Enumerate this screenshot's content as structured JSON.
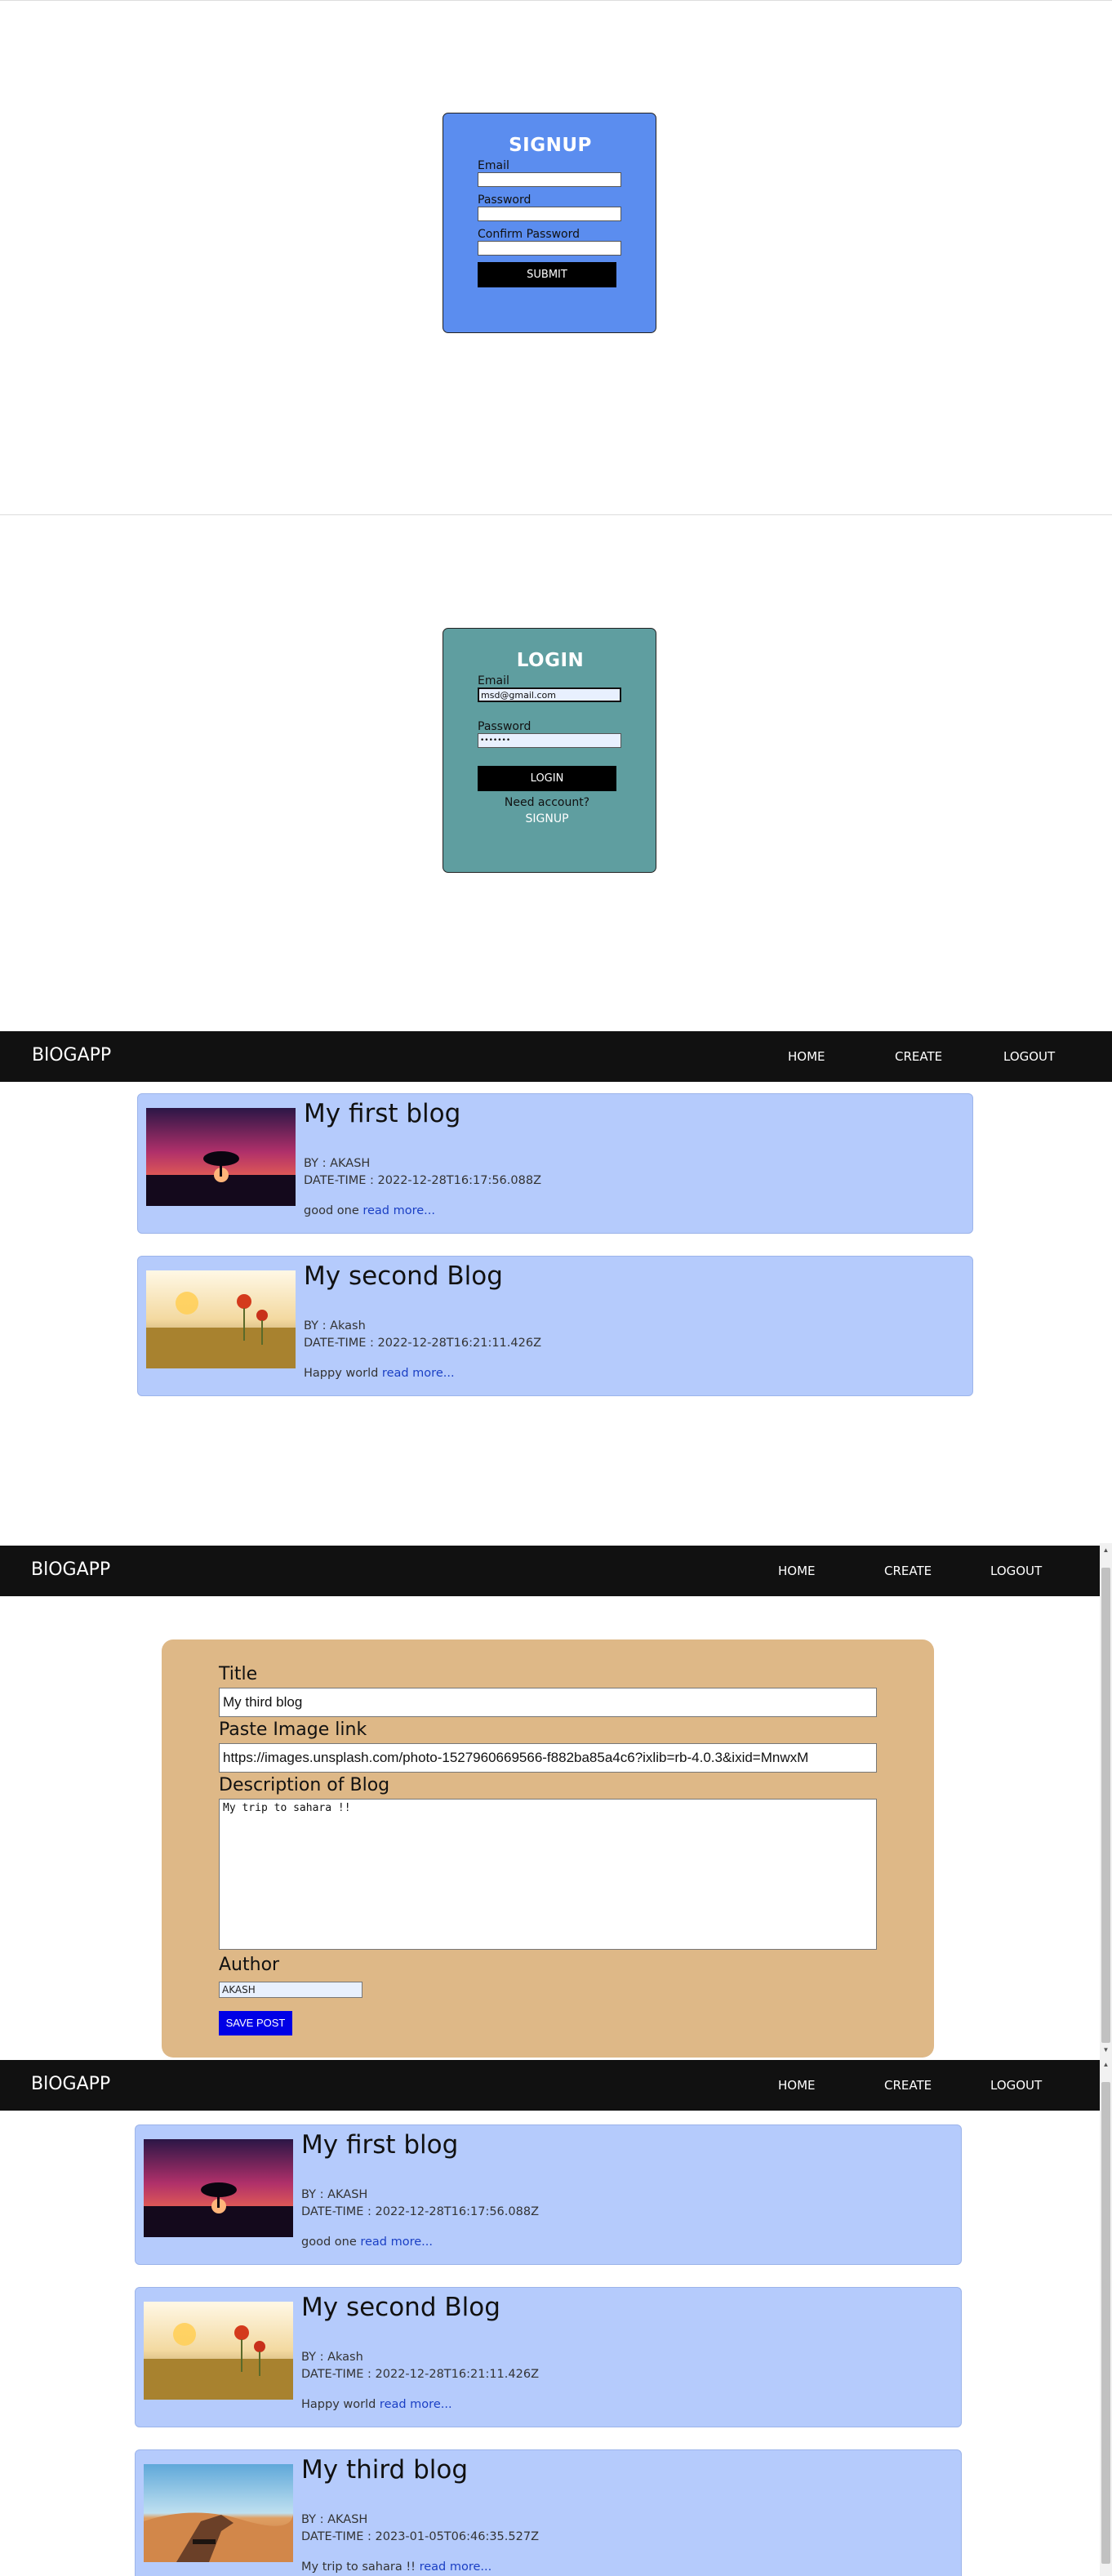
{
  "signup": {
    "title": "SIGNUP",
    "email_label": "Email",
    "password_label": "Password",
    "confirm_label": "Confirm Password",
    "submit_label": "SUBMIT",
    "card_color": "#5b8def"
  },
  "login": {
    "title": "LOGIN",
    "email_label": "Email",
    "email_value": "msd@gmail.com",
    "password_label": "Password",
    "password_value": "•••••••",
    "submit_label": "LOGIN",
    "need_account": "Need account?",
    "signup_link": "SIGNUP",
    "card_color": "#5f9ea0"
  },
  "nav": {
    "brand": "BlOGAPP",
    "home": "HOME",
    "create": "CREATE",
    "logout": "LOGOUT"
  },
  "blogs": [
    {
      "title": "My first blog",
      "author": "BY : AKASH",
      "datetime": "DATE-TIME : 2022-12-28T16:17:56.088Z",
      "excerpt": "good one",
      "image": "purple-sunset-tree"
    },
    {
      "title": "My second Blog",
      "author": "BY : Akash",
      "datetime": "DATE-TIME : 2022-12-28T16:21:11.426Z",
      "excerpt": "Happy world",
      "image": "poppy-field-sunlight"
    },
    {
      "title": "My third blog",
      "author": "BY : AKASH",
      "datetime": "DATE-TIME : 2023-01-05T06:46:35.527Z",
      "excerpt": "My trip to sahara !!",
      "image": "desert-hand-bracelet"
    }
  ],
  "readmore": "read more...",
  "create_form": {
    "title_label": "Title",
    "title_value": "My third blog",
    "image_label": "Paste Image link",
    "image_value": "https://images.unsplash.com/photo-1527960669566-f882ba85a4c6?ixlib=rb-4.0.3&ixid=MnwxM",
    "description_label": "Description of Blog",
    "description_value": "My trip to sahara !!",
    "author_label": "Author",
    "author_value": "AKASH",
    "save_label": "SAVE POST",
    "panel_color": "#deb887",
    "button_color": "#0000e6"
  },
  "scroll_arrows": {
    "up": "▲",
    "down": "▼"
  }
}
